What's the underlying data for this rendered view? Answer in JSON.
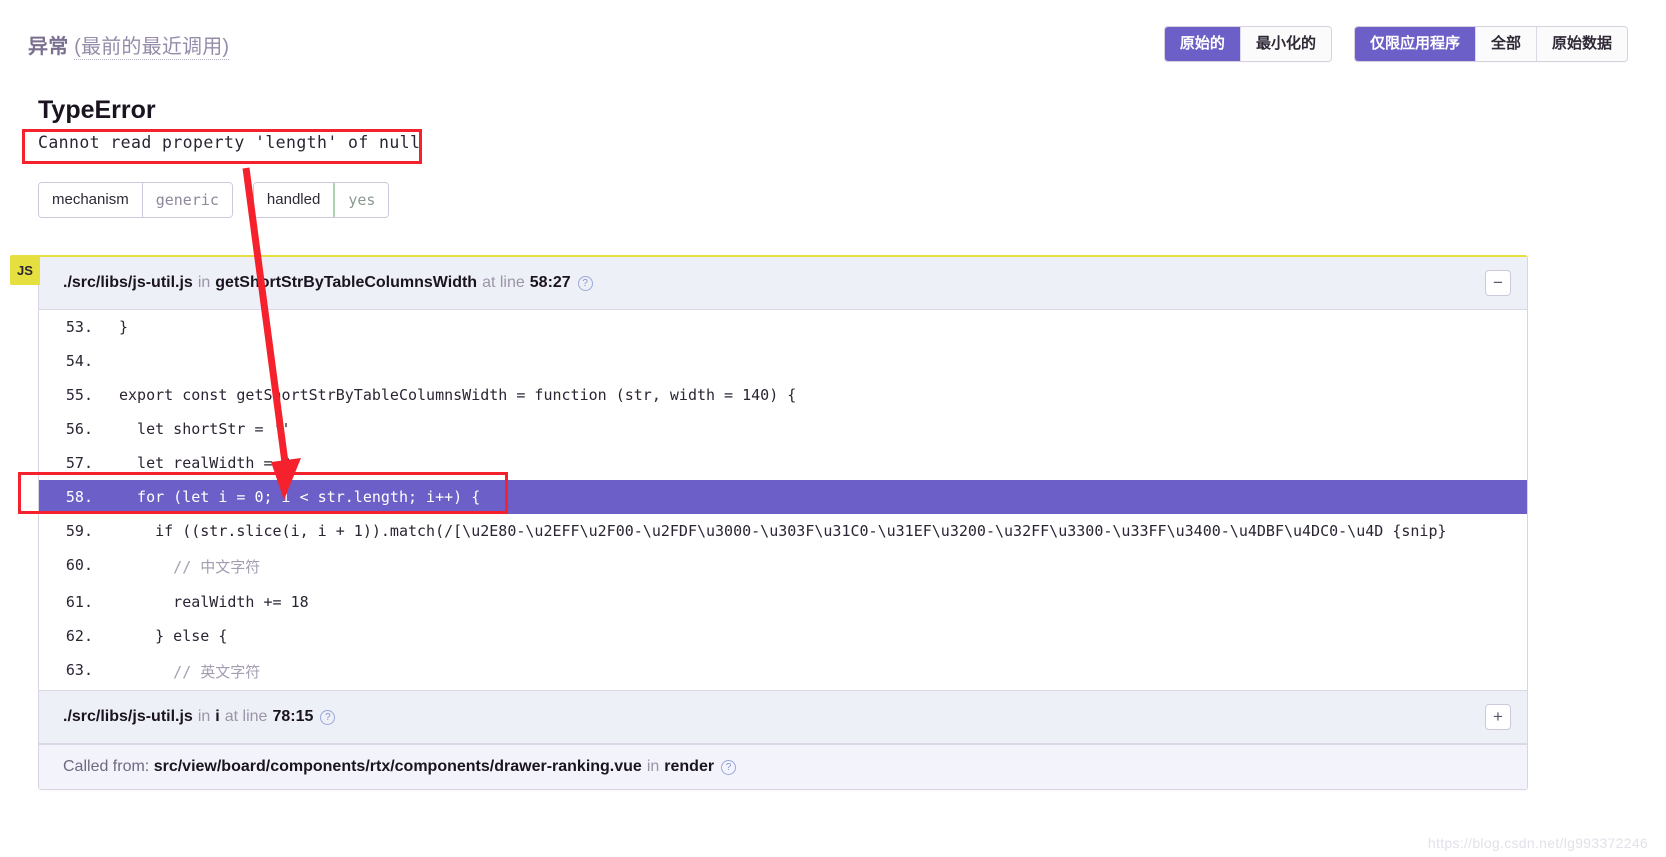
{
  "header": {
    "title_strong": "异常",
    "title_rest": "(最前的最近调用)",
    "button_groups": [
      {
        "name": "format-toggle",
        "buttons": [
          {
            "label": "原始的",
            "active": true
          },
          {
            "label": "最小化的",
            "active": false
          }
        ]
      },
      {
        "name": "scope-toggle",
        "buttons": [
          {
            "label": "仅限应用程序",
            "active": true
          },
          {
            "label": "全部",
            "active": false
          },
          {
            "label": "原始数据",
            "active": false
          }
        ]
      }
    ],
    "accent_color": "#6c5fc7"
  },
  "error": {
    "type": "TypeError",
    "message": "Cannot read property 'length' of null",
    "tags": [
      {
        "key": "mechanism",
        "value": "generic",
        "status": "neutral"
      },
      {
        "key": "handled",
        "value": "yes",
        "status": "ok"
      }
    ],
    "annotation_color": "#f5222d"
  },
  "trace": {
    "language_badge": "JS",
    "frames": [
      {
        "file": "./src/libs/js-util.js",
        "in_label": "in",
        "function": "getShortStrByTableColumnsWidth",
        "at_label": "at line",
        "line": "58:27",
        "help_icon": "question-mark-icon",
        "toggle": "−",
        "expanded": true,
        "code": [
          {
            "num": "53.",
            "text": "}",
            "active": false
          },
          {
            "num": "54.",
            "text": "",
            "active": false
          },
          {
            "num": "55.",
            "text": "export const getShortStrByTableColumnsWidth = function (str, width = 140) {",
            "active": false
          },
          {
            "num": "56.",
            "text": "  let shortStr = ''",
            "active": false
          },
          {
            "num": "57.",
            "text": "  let realWidth = 0",
            "active": false
          },
          {
            "num": "58.",
            "text": "  for (let i = 0; i < str.length; i++) {",
            "active": true
          },
          {
            "num": "59.",
            "text": "    if ((str.slice(i, i + 1)).match(/[\\u2E80-\\u2EFF\\u2F00-\\u2FDF\\u3000-\\u303F\\u31C0-\\u31EF\\u3200-\\u32FF\\u3300-\\u33FF\\u3400-\\u4DBF\\u4DC0-\\u4D {snip}",
            "active": false
          },
          {
            "num": "60.",
            "text": "      // 中文字符",
            "active": false,
            "comment": true
          },
          {
            "num": "61.",
            "text": "      realWidth += 18",
            "active": false
          },
          {
            "num": "62.",
            "text": "    } else {",
            "active": false
          },
          {
            "num": "63.",
            "text": "      // 英文字符",
            "active": false,
            "comment": true
          }
        ]
      },
      {
        "file": "./src/libs/js-util.js",
        "in_label": "in",
        "function": "i",
        "at_label": "at line",
        "line": "78:15",
        "help_icon": "question-mark-icon",
        "toggle": "+",
        "expanded": false,
        "code": []
      }
    ],
    "called_from": {
      "prefix": "Called from:",
      "path": "src/view/board/components/rtx/components/drawer-ranking.vue",
      "in_label": "in",
      "function": "render",
      "help_icon": "question-mark-icon"
    }
  },
  "watermark": "https://blog.csdn.net/lg993372246"
}
